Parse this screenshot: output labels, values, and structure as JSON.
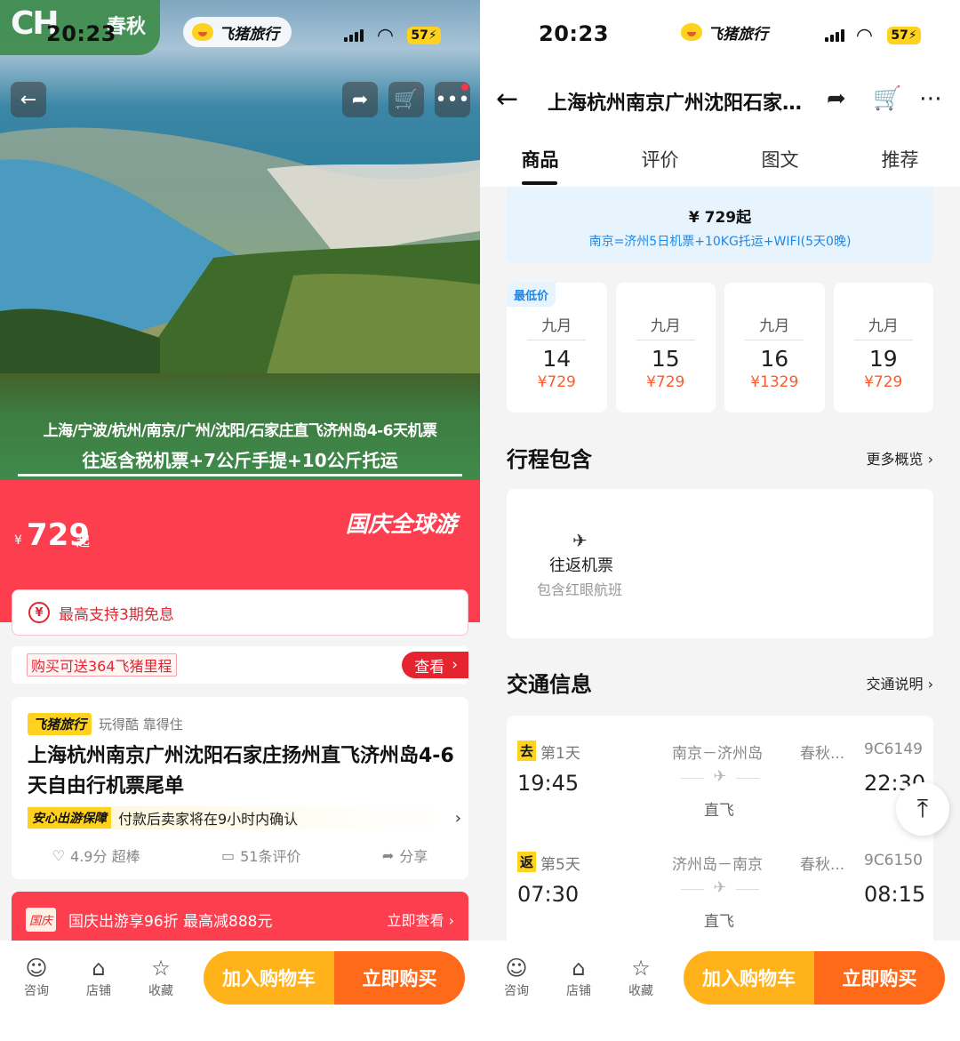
{
  "left": {
    "status": {
      "time": "20:23",
      "battery": "57"
    },
    "brand_pill": "飞猪旅行",
    "watermark": {
      "logo_text": "CH",
      "label": "春秋"
    },
    "hero": {
      "title": "上海/宁波/杭州/南京/广州/沈阳/石家庄直飞济州岛4-6天机票",
      "subtitle": "往返含税机票+7公斤手提+10公斤托运"
    },
    "price": {
      "currency": "¥",
      "value": "729",
      "suffix": "起",
      "campaign": "国庆全球游"
    },
    "installment": {
      "icon": "¥",
      "text": "最高支持3期免息"
    },
    "miles": {
      "text": "购买可送364飞猪里程",
      "button": "查看"
    },
    "product": {
      "badge": "飞猪旅行",
      "slogan": "玩得酷 靠得住",
      "title": "上海杭州南京广州沈阳石家庄扬州直飞济州岛4-6天自由行机票尾单",
      "assure_badge": "安心出游保障",
      "assure_text": "付款后卖家将在9小时内确认",
      "rating": "4.9分 超棒",
      "reviews": "51条评价",
      "share": "分享"
    },
    "promo": {
      "badge": "国庆",
      "text": "国庆出游享96折 最高减888元",
      "action": "立即查看"
    },
    "bottom": {
      "consult": "咨询",
      "shop": "店铺",
      "fav": "收藏",
      "cart": "加入购物车",
      "buy": "立即购买"
    }
  },
  "right": {
    "status": {
      "time": "20:23",
      "battery": "57"
    },
    "brand_pill": "飞猪旅行",
    "nav_title": "上海杭州南京广州沈阳石家庄扬州直飞济州岛4-6天自由行机票尾单",
    "tabs": [
      "商品",
      "评价",
      "图文",
      "推荐"
    ],
    "package": {
      "price": "¥ 729起",
      "desc": "南京=济州5日机票+10KG托运+WIFI(5天0晚)"
    },
    "lowest_label": "最低价",
    "dates": [
      {
        "month": "九月",
        "day": "14",
        "price": "¥729"
      },
      {
        "month": "九月",
        "day": "15",
        "price": "¥729"
      },
      {
        "month": "九月",
        "day": "16",
        "price": "¥1329"
      },
      {
        "month": "九月",
        "day": "19",
        "price": "¥729"
      }
    ],
    "itinerary": {
      "heading": "行程包含",
      "more": "更多概览",
      "item": "往返机票",
      "item_sub": "包含红眼航班"
    },
    "traffic": {
      "heading": "交通信息",
      "more": "交通说明",
      "legs": [
        {
          "tag": "去",
          "day": "第1天",
          "dep": "19:45",
          "route": "南京－济州岛",
          "airline": "春秋...",
          "flight": "9C6149",
          "arr": "22:30",
          "type": "直飞"
        },
        {
          "tag": "返",
          "day": "第5天",
          "dep": "07:30",
          "route": "济州岛－南京",
          "airline": "春秋...",
          "flight": "9C6150",
          "arr": "08:15",
          "type": "直飞"
        }
      ]
    },
    "bottom": {
      "consult": "咨询",
      "shop": "店铺",
      "fav": "收藏",
      "cart": "加入购物车",
      "buy": "立即购买"
    }
  }
}
